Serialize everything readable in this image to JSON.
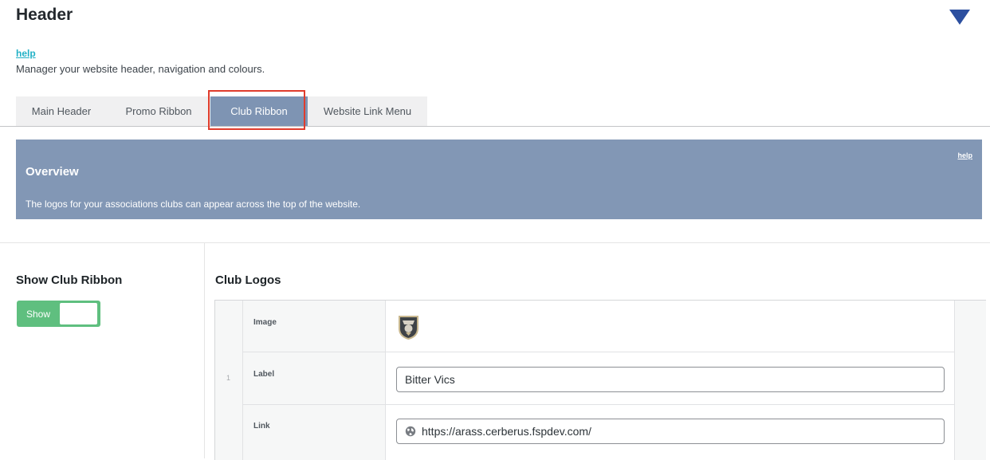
{
  "header": {
    "title": "Header",
    "help_label": "help",
    "subtitle": "Manager your website header, navigation and colours."
  },
  "tabs": [
    {
      "label": "Main Header",
      "active": false
    },
    {
      "label": "Promo Ribbon",
      "active": false
    },
    {
      "label": "Club Ribbon",
      "active": true
    },
    {
      "label": "Website Link Menu",
      "active": false
    }
  ],
  "overview": {
    "title": "Overview",
    "text": "The logos for your associations clubs can appear across the top of the website.",
    "help_label": "help"
  },
  "show_club_ribbon": {
    "heading": "Show Club Ribbon",
    "toggle_label": "Show",
    "enabled": true
  },
  "club_logos": {
    "heading": "Club Logos",
    "rows": [
      {
        "number": "1",
        "image_label": "Image",
        "label_label": "Label",
        "label_value": "Bitter Vics",
        "link_label": "Link",
        "link_value": "https://arass.cerberus.fspdev.com/"
      }
    ]
  },
  "colors": {
    "accent_blue": "#2c4f9f",
    "help_link": "#21b1c6",
    "active_tab": "#7e94b3",
    "overview_bg": "#8297b5",
    "toggle_on": "#5fbf7f",
    "highlight_box": "#e03c2c"
  },
  "icons": [
    "chevron-down-icon",
    "globe-icon",
    "club-logo-image"
  ]
}
